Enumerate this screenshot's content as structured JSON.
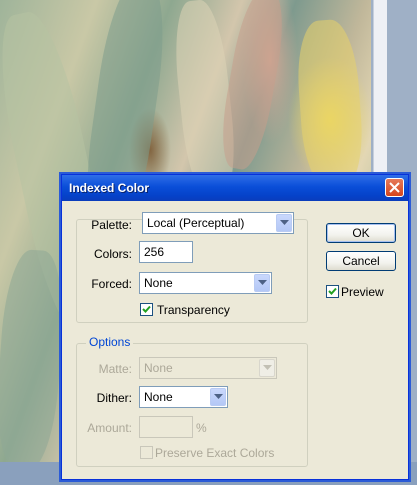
{
  "dialog": {
    "title": "Indexed Color",
    "palette": {
      "label": "Palette:",
      "value": "Local (Perceptual)"
    },
    "colors": {
      "label": "Colors:",
      "value": "256"
    },
    "forced": {
      "label": "Forced:",
      "value": "None"
    },
    "transparency": {
      "label": "Transparency",
      "checked": true
    },
    "options": {
      "legend": "Options",
      "matte": {
        "label": "Matte:",
        "value": "None"
      },
      "dither": {
        "label": "Dither:",
        "value": "None"
      },
      "amount": {
        "label": "Amount:",
        "value": "",
        "unit": "%"
      },
      "preserve": {
        "label": "Preserve Exact Colors",
        "checked": false
      }
    },
    "buttons": {
      "ok": "OK",
      "cancel": "Cancel"
    },
    "preview": {
      "label": "Preview",
      "checked": true
    }
  },
  "colors": {
    "accent": "#0046d5",
    "titlebar": "#0a4ed8",
    "dialog_bg": "#ece9d8"
  }
}
